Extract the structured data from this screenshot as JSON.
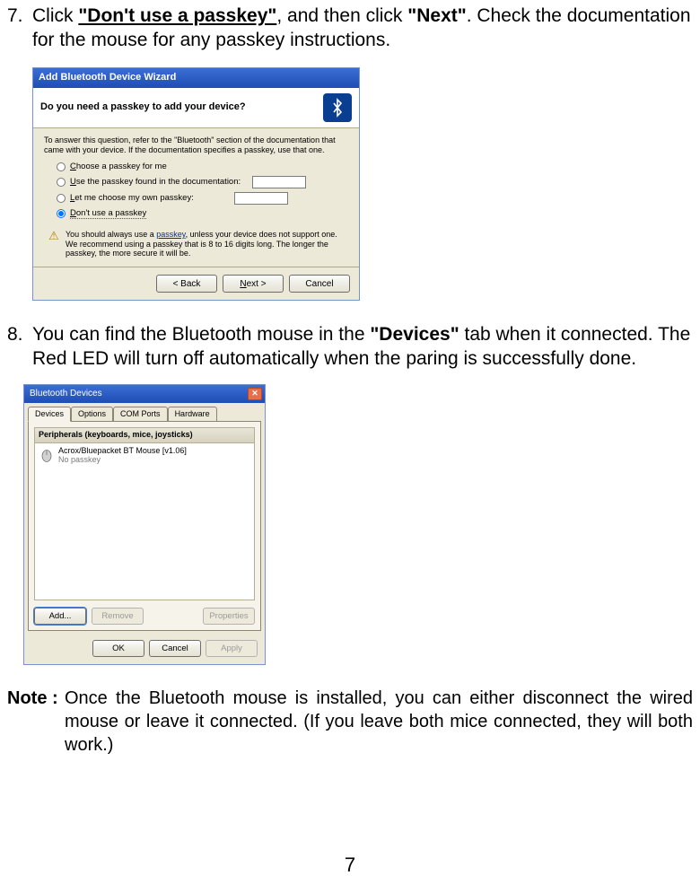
{
  "step7": {
    "num": "7.",
    "pre": "Click ",
    "bold1": "\"Don't use a passkey\"",
    "mid": ", and then click ",
    "bold2": "\"Next\"",
    "post": ". Check the documentation for the mouse for any passkey instructions."
  },
  "wizard": {
    "title": "Add Bluetooth Device Wizard",
    "header": "Do you need a passkey to add your device?",
    "intro": "To answer this question, refer to the \"Bluetooth\" section of the documentation that came with your device. If the documentation specifies a passkey, use that one.",
    "radios": {
      "r1": "Choose a passkey for me",
      "r2": "Use the passkey found in the documentation:",
      "r3": "Let me choose my own passkey:",
      "r4": "Don't use a passkey"
    },
    "warn_pre": "You should always use a ",
    "warn_link": "passkey",
    "warn_post": ", unless your device does not support one. We recommend using a passkey that is 8 to 16 digits long. The longer the passkey, the more secure it will be.",
    "buttons": {
      "back": "< Back",
      "next": "Next >",
      "cancel": "Cancel"
    }
  },
  "step8": {
    "num": "8.",
    "pre": "You can find the Bluetooth mouse in the ",
    "bold": "\"Devices\"",
    "post": " tab when it connected. The Red LED will turn off automatically when the paring is successfully done."
  },
  "devices": {
    "title": "Bluetooth Devices",
    "tabs": {
      "t1": "Devices",
      "t2": "Options",
      "t3": "COM Ports",
      "t4": "Hardware"
    },
    "periph_header": "Peripherals (keyboards, mice, joysticks)",
    "device_name": "Acrox/Bluepacket BT Mouse [v1.06]",
    "device_sub": "No passkey",
    "row_buttons": {
      "add": "Add...",
      "remove": "Remove",
      "props": "Properties"
    },
    "footer": {
      "ok": "OK",
      "cancel": "Cancel",
      "apply": "Apply"
    }
  },
  "note": {
    "label": "Note :",
    "text": "Once the Bluetooth mouse is installed, you can either disconnect the wired mouse or leave it connected. (If you leave both mice connected, they will both work.)"
  },
  "page_number": "7"
}
